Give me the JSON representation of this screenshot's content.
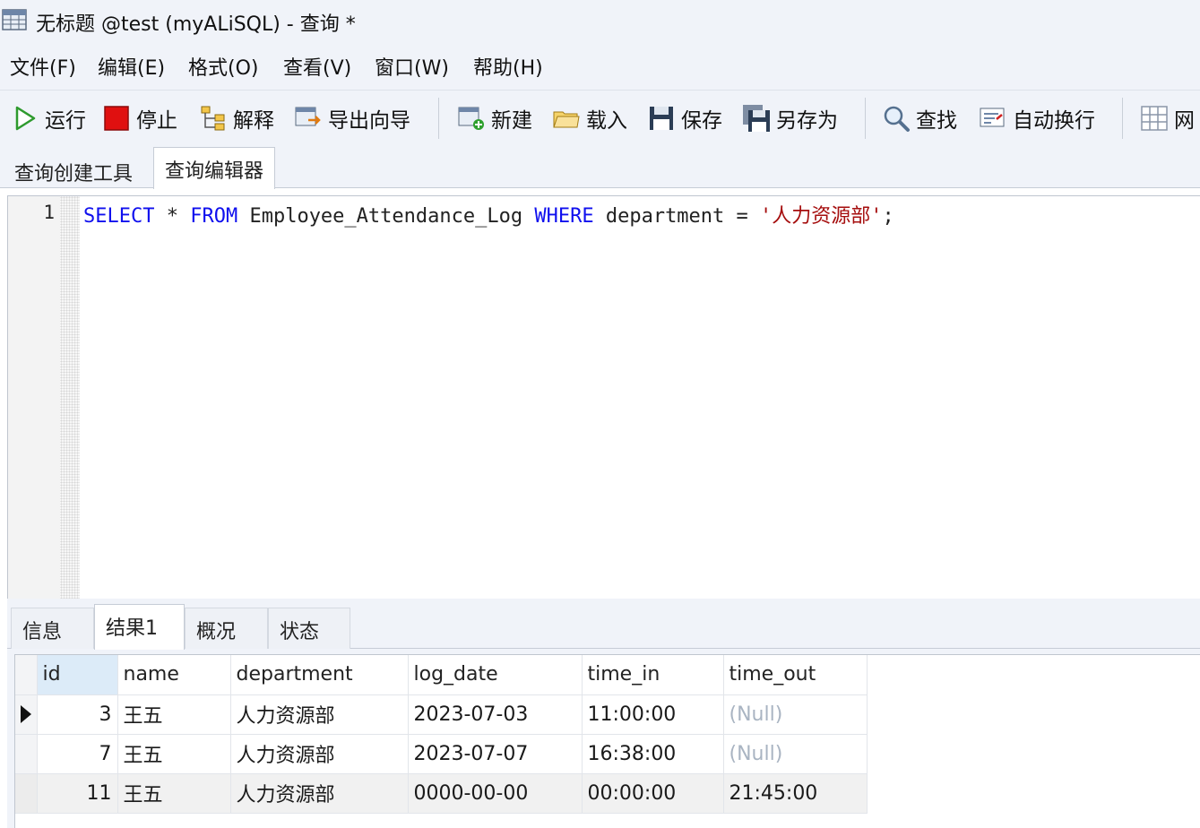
{
  "window": {
    "title": "无标题 @test (myALiSQL) - 查询 *"
  },
  "menu": [
    {
      "label": "文件(F)"
    },
    {
      "label": "编辑(E)"
    },
    {
      "label": "格式(O)"
    },
    {
      "label": "查看(V)"
    },
    {
      "label": "窗口(W)"
    },
    {
      "label": "帮助(H)"
    }
  ],
  "toolbar": {
    "run": "运行",
    "stop": "停止",
    "explain": "解释",
    "export_wizard": "导出向导",
    "new": "新建",
    "load": "载入",
    "save": "保存",
    "save_as": "另存为",
    "find": "查找",
    "word_wrap": "自动换行",
    "grid_partial": "网"
  },
  "editor_tabs": [
    {
      "label": "查询创建工具",
      "active": false
    },
    {
      "label": "查询编辑器",
      "active": true
    }
  ],
  "editor": {
    "line_number": "1",
    "sql": {
      "kw_select": "SELECT",
      "star": " * ",
      "kw_from": "FROM",
      "table": " Employee_Attendance_Log ",
      "kw_where": "WHERE",
      "condition": " department = ",
      "quote_open": "'",
      "value": "人力资源部",
      "quote_close": "'",
      "terminator": ";"
    }
  },
  "result_tabs": [
    {
      "label": "信息",
      "active": false
    },
    {
      "label": "结果1",
      "active": true
    },
    {
      "label": "概况",
      "active": false
    },
    {
      "label": "状态",
      "active": false
    }
  ],
  "results": {
    "columns": [
      "id",
      "name",
      "department",
      "log_date",
      "time_in",
      "time_out"
    ],
    "rows": [
      {
        "id": "3",
        "name": "王五",
        "department": "人力资源部",
        "log_date": "2023-07-03",
        "time_in": "11:00:00",
        "time_out": "(Null)"
      },
      {
        "id": "7",
        "name": "王五",
        "department": "人力资源部",
        "log_date": "2023-07-07",
        "time_in": "16:38:00",
        "time_out": "(Null)"
      },
      {
        "id": "11",
        "name": "王五",
        "department": "人力资源部",
        "log_date": "0000-00-00",
        "time_in": "00:00:00",
        "time_out": "21:45:00"
      }
    ]
  },
  "colors": {
    "keyword": "#1010ee",
    "string": "#a50d0d",
    "null_text": "#a9b4c2",
    "chrome_bg": "#f0f3f9"
  }
}
